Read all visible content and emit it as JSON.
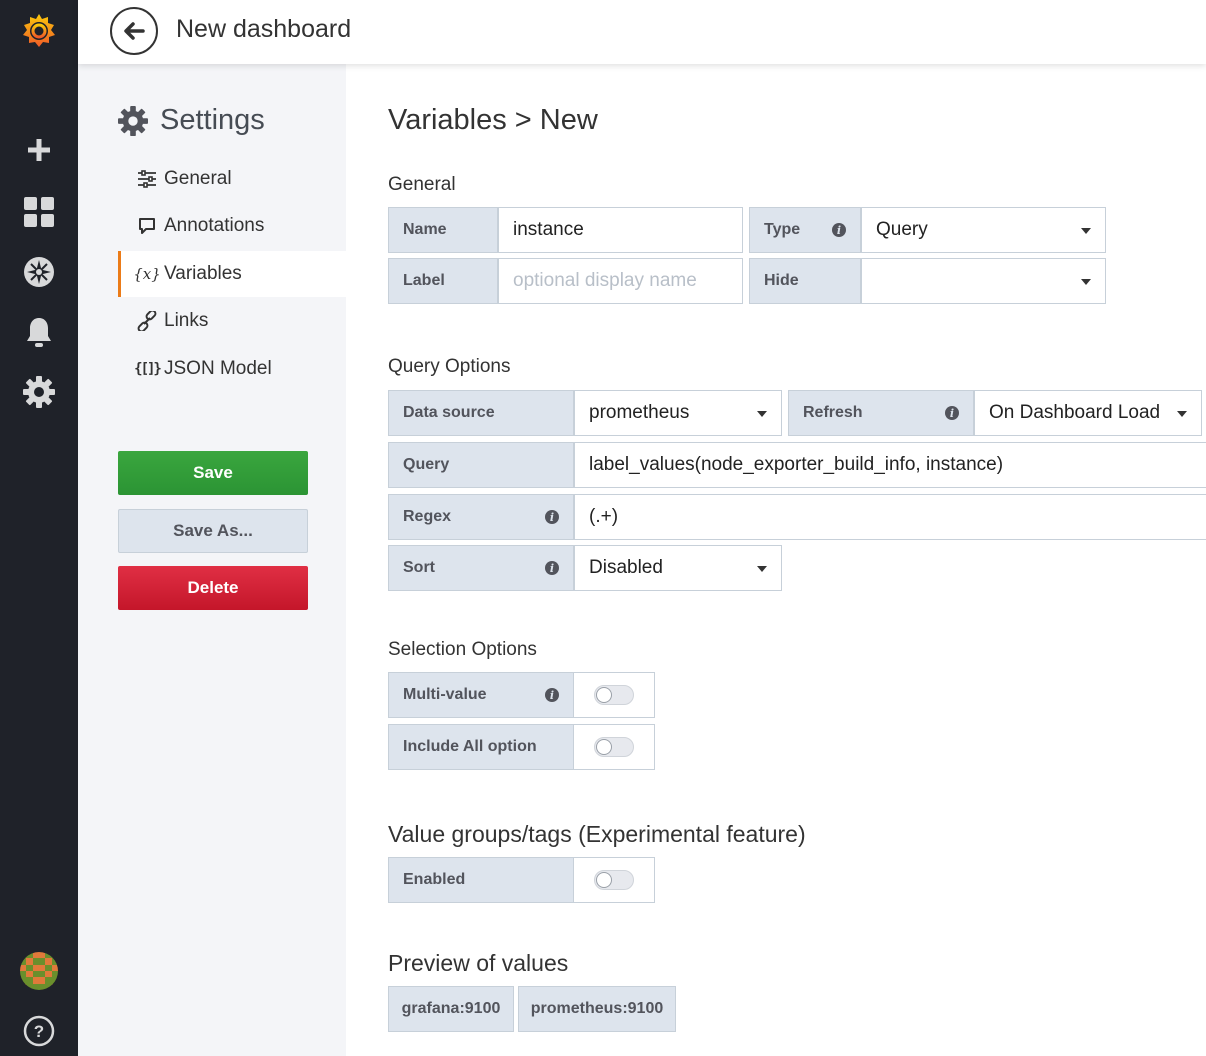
{
  "topbar": {
    "title": "New dashboard"
  },
  "settings": {
    "heading": "Settings",
    "nav": [
      {
        "label": "General"
      },
      {
        "label": "Annotations"
      },
      {
        "label": "Variables"
      },
      {
        "label": "Links"
      },
      {
        "label": "JSON Model"
      }
    ],
    "buttons": {
      "save": "Save",
      "save_as": "Save As...",
      "delete": "Delete"
    }
  },
  "main": {
    "title": "Variables > New",
    "general": {
      "heading": "General",
      "name_label": "Name",
      "name_value": "instance",
      "type_label": "Type",
      "type_value": "Query",
      "label_label": "Label",
      "label_placeholder": "optional display name",
      "hide_label": "Hide",
      "hide_value": ""
    },
    "query_options": {
      "heading": "Query Options",
      "datasource_label": "Data source",
      "datasource_value": "prometheus",
      "refresh_label": "Refresh",
      "refresh_value": "On Dashboard Load",
      "query_label": "Query",
      "query_value": "label_values(node_exporter_build_info, instance)",
      "regex_label": "Regex",
      "regex_value": "(.+)",
      "sort_label": "Sort",
      "sort_value": "Disabled"
    },
    "selection_options": {
      "heading": "Selection Options",
      "multi_value_label": "Multi-value",
      "multi_value_on": false,
      "include_all_label": "Include All option",
      "include_all_on": false
    },
    "value_groups": {
      "heading": "Value groups/tags (Experimental feature)",
      "enabled_label": "Enabled",
      "enabled_on": false
    },
    "preview": {
      "heading": "Preview of values",
      "values": [
        "grafana:9100",
        "prometheus:9100"
      ]
    }
  },
  "colors": {
    "sidenav_bg": "#1f2229",
    "accent_orange": "#eb7b18",
    "save_green": "#2b9434",
    "delete_red": "#e02f44",
    "label_bg": "#dde4ed"
  }
}
